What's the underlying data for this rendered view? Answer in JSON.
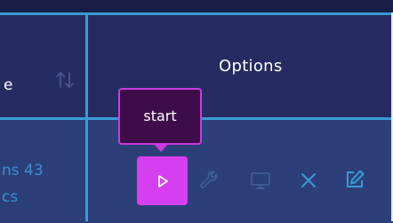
{
  "table": {
    "partial_column_header": "e",
    "options_header": "Options",
    "partial_cell_lines": [
      "ns 43",
      "cs"
    ]
  },
  "tooltip": {
    "text": "start"
  },
  "actions": [
    {
      "name": "play-icon",
      "state": "active"
    },
    {
      "name": "wrench-icon",
      "state": "disabled"
    },
    {
      "name": "monitor-icon",
      "state": "disabled"
    },
    {
      "name": "close-icon",
      "state": "enabled"
    },
    {
      "name": "edit-icon",
      "state": "enabled"
    }
  ],
  "colors": {
    "header_bg": "#262c61",
    "row_bg": "#2c3f79",
    "grid_line": "#3a9bd8",
    "accent": "#d63ff0",
    "tooltip_bg": "#3f0c4a",
    "icon_enabled": "#3a9bd8",
    "icon_disabled": "#415e97"
  }
}
